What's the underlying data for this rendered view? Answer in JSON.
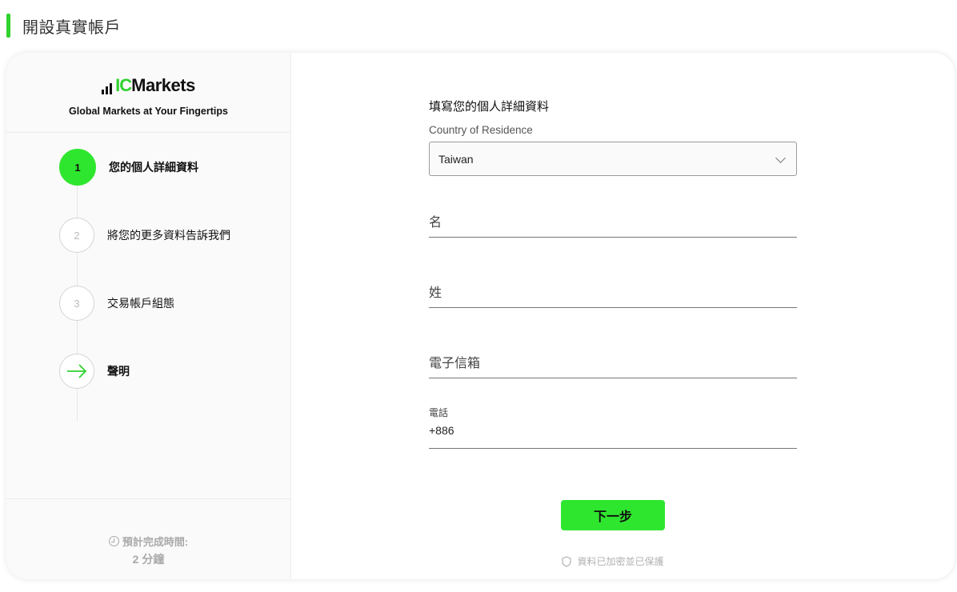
{
  "page": {
    "title": "開設真實帳戶",
    "accent_color": "#2fe62f"
  },
  "brand": {
    "logo_ic": "IC",
    "logo_markets": "Markets",
    "tagline": "Global Markets at Your Fingertips"
  },
  "steps": [
    {
      "number": "1",
      "label": "您的個人詳細資料",
      "state": "active"
    },
    {
      "number": "2",
      "label": "將您的更多資料告訴我們",
      "state": "pending"
    },
    {
      "number": "3",
      "label": "交易帳戶組態",
      "state": "pending"
    },
    {
      "icon": "arrow-right-icon",
      "label": "聲明",
      "state": "pending"
    }
  ],
  "eta": {
    "label": "預計完成時間:",
    "value": "2 分鐘"
  },
  "form": {
    "title": "填寫您的個人詳細資料",
    "country": {
      "label": "Country of Residence",
      "value": "Taiwan"
    },
    "first_name": {
      "placeholder": "名"
    },
    "last_name": {
      "placeholder": "姓"
    },
    "email": {
      "placeholder": "電子信箱"
    },
    "phone": {
      "label": "電話",
      "value": "+886"
    },
    "next_label": "下一步",
    "secure_note": "資料已加密並已保護"
  }
}
